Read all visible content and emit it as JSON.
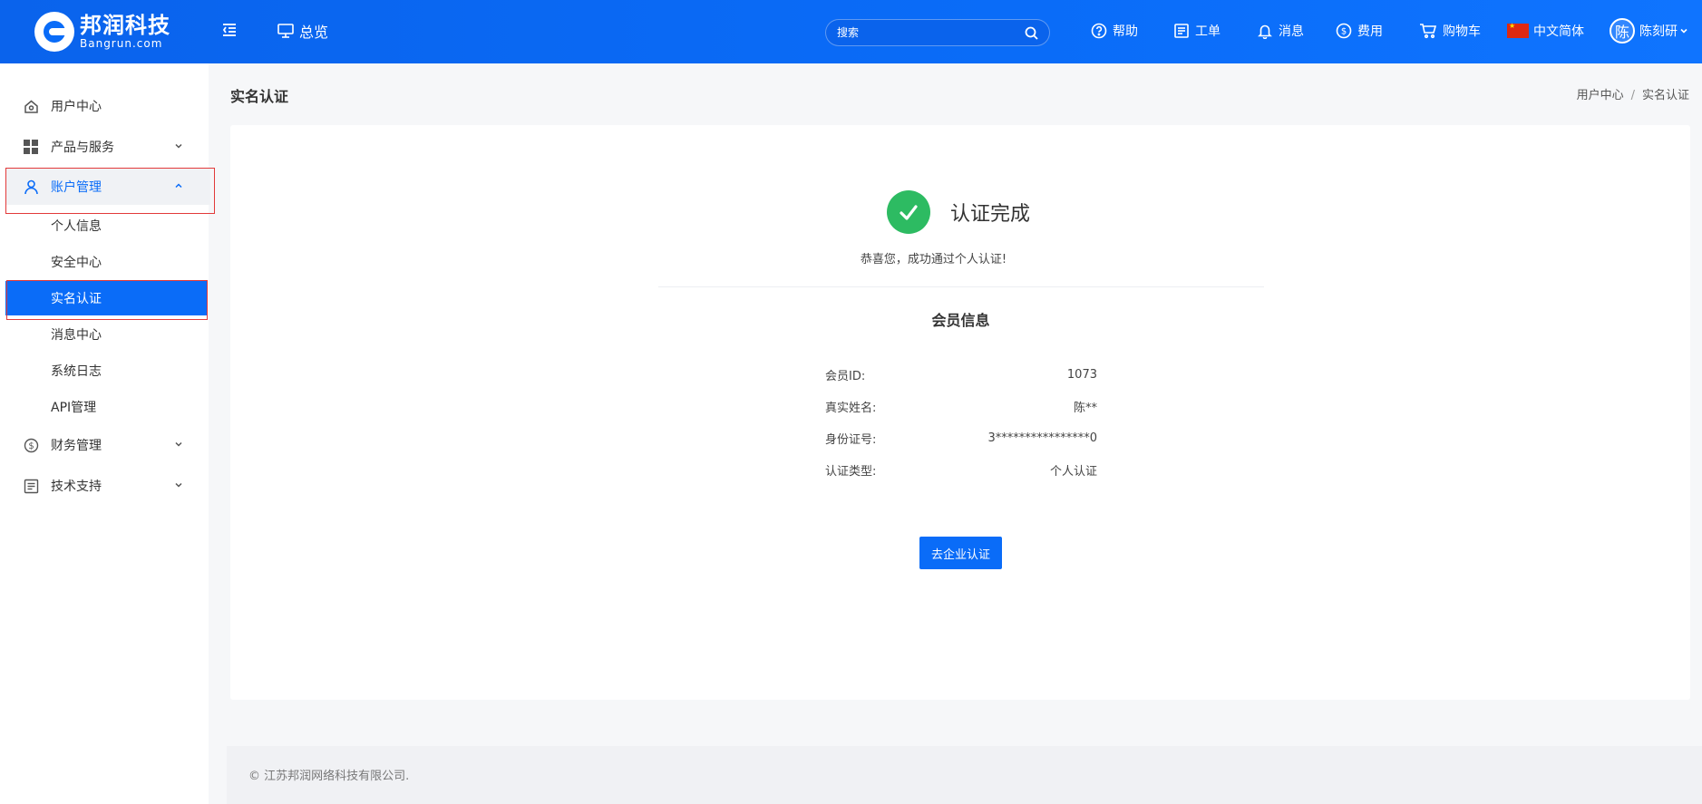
{
  "header": {
    "logo_cn": "邦润科技",
    "logo_en": "Bangrun.com",
    "overview": "总览",
    "search_placeholder": "搜索",
    "nav": {
      "help": "帮助",
      "ticket": "工单",
      "messages": "消息",
      "billing": "费用",
      "cart": "购物车",
      "language": "中文简体",
      "user_avatar": "陈",
      "user_name": "陈刻研"
    }
  },
  "sidebar": {
    "user_center": "用户中心",
    "products": "产品与服务",
    "account": "账户管理",
    "sub": {
      "profile": "个人信息",
      "security": "安全中心",
      "realname": "实名认证",
      "messages": "消息中心",
      "logs": "系统日志",
      "api": "API管理"
    },
    "finance": "财务管理",
    "support": "技术支持"
  },
  "main": {
    "page_title": "实名认证",
    "breadcrumb": [
      "用户中心",
      "实名认证"
    ],
    "status_title": "认证完成",
    "status_desc": "恭喜您，成功通过个人认证!",
    "member_title": "会员信息",
    "rows": [
      {
        "label": "会员ID:",
        "value": "1073"
      },
      {
        "label": "真实姓名:",
        "value": "陈**"
      },
      {
        "label": "身份证号:",
        "value": "3****************0"
      },
      {
        "label": "认证类型:",
        "value": "个人认证"
      }
    ],
    "button": "去企业认证"
  },
  "footer": {
    "copyright": "© 江苏邦润网络科技有限公司."
  },
  "colors": {
    "primary": "#0a6cf8",
    "success": "#2dbb62",
    "highlight": "#e23a3a"
  }
}
